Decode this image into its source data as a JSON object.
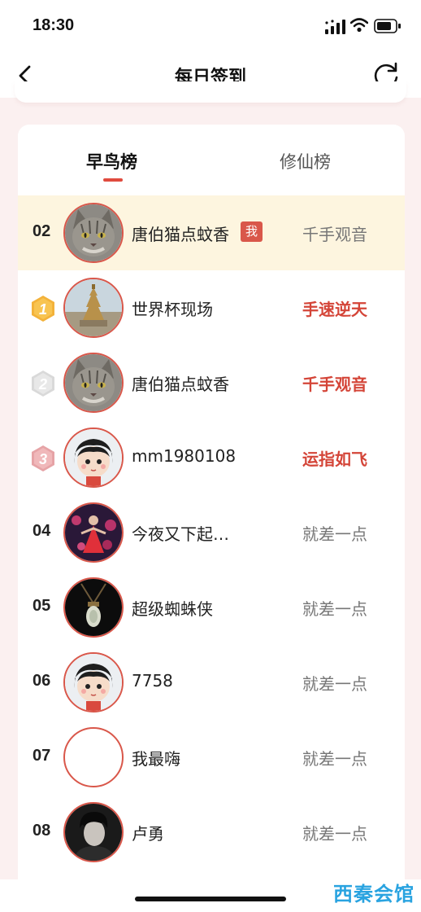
{
  "status_bar": {
    "time": "18:30"
  },
  "nav": {
    "title": "每日签到"
  },
  "tabs": [
    {
      "label": "早鸟榜",
      "active": true
    },
    {
      "label": "修仙榜",
      "active": false
    }
  ],
  "colors": {
    "accent": "#d9574a",
    "highlight_row": "#fdf5df",
    "page_bg": "#fbf0f0"
  },
  "rows": [
    {
      "rank": "02",
      "name": "唐伯猫点蚊香",
      "badge": "我",
      "title": "千手观音",
      "title_style": "gray",
      "avatar": "cat-avatar-icon",
      "is_me": true
    },
    {
      "rank": "1",
      "name": "世界杯现场",
      "title": "手速逆天",
      "title_style": "red",
      "avatar": "temple-avatar-icon",
      "medal": "gold"
    },
    {
      "rank": "2",
      "name": "唐伯猫点蚊香",
      "title": "千手观音",
      "title_style": "red",
      "avatar": "cat-avatar-icon",
      "medal": "silver"
    },
    {
      "rank": "3",
      "name": "mm1980108",
      "title": "运指如飞",
      "title_style": "red",
      "avatar": "cartoon-girl-avatar-icon",
      "medal": "bronze"
    },
    {
      "rank": "04",
      "name": "今夜又下起…",
      "title": "就差一点",
      "title_style": "gray",
      "avatar": "dancer-avatar-icon"
    },
    {
      "rank": "05",
      "name": "超级蜘蛛侠",
      "title": "就差一点",
      "title_style": "gray",
      "avatar": "jade-pendant-avatar-icon"
    },
    {
      "rank": "06",
      "name": "7758",
      "title": "就差一点",
      "title_style": "gray",
      "avatar": "cartoon-girl-avatar-icon"
    },
    {
      "rank": "07",
      "name": "我最嗨",
      "title": "就差一点",
      "title_style": "gray",
      "avatar": "blank-avatar"
    },
    {
      "rank": "08",
      "name": "卢勇",
      "title": "就差一点",
      "title_style": "gray",
      "avatar": "man-photo-avatar-icon"
    }
  ],
  "watermark": "西秦会馆"
}
